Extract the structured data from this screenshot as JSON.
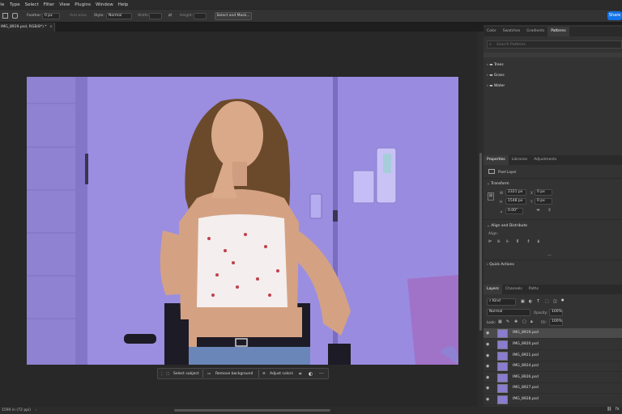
{
  "menubar": {
    "items": [
      "File",
      "Type",
      "Select",
      "Filter",
      "View",
      "Plugins",
      "Window",
      "Help"
    ]
  },
  "options": {
    "feather_label": "Feather:",
    "feather_value": "0 px",
    "anti_alias": "Anti-alias",
    "style_label": "Style:",
    "style_value": "Normal",
    "width_label": "Width:",
    "height_label": "Height:",
    "select_mask": "Select and Mask..."
  },
  "share": "Share",
  "doc_tab": "IMG_8919.psd, RGB/8*) *",
  "context_bar": {
    "select_subject": "Select subject",
    "remove_background": "Remove background",
    "adjust_colors": "Adjust colors"
  },
  "status": {
    "zoom": "1590 in (72 ppi)"
  },
  "top_panel": {
    "tabs": [
      "Color",
      "Swatches",
      "Gradients",
      "Patterns"
    ],
    "search_placeholder": "Search Patterns",
    "folders": [
      "Trees",
      "Grass",
      "Water"
    ]
  },
  "properties": {
    "tabs": [
      "Properties",
      "Libraries",
      "Adjustments"
    ],
    "pixel_layer": "Pixel Layer",
    "transform": "Transform",
    "w": "2321 px",
    "h": "1548 px",
    "x": "0 px",
    "y": "0 px",
    "angle": "0.00°",
    "align": "Align and Distribute",
    "align_label": "Align:",
    "quick": "Quick Actions"
  },
  "layers": {
    "tabs": [
      "Layers",
      "Channels",
      "Paths"
    ],
    "kind": "Kind",
    "blend": "Normal",
    "opacity_label": "Opacity:",
    "opacity": "100%",
    "lock_label": "Lock:",
    "fill_label": "Fill:",
    "fill": "100%",
    "items": [
      "IMG_8919.psd",
      "IMG_8920.psd",
      "IMG_8921.psd",
      "IMG_8924.psd",
      "IMG_8926.psd",
      "IMG_8927.psd",
      "IMG_8928.psd"
    ]
  }
}
